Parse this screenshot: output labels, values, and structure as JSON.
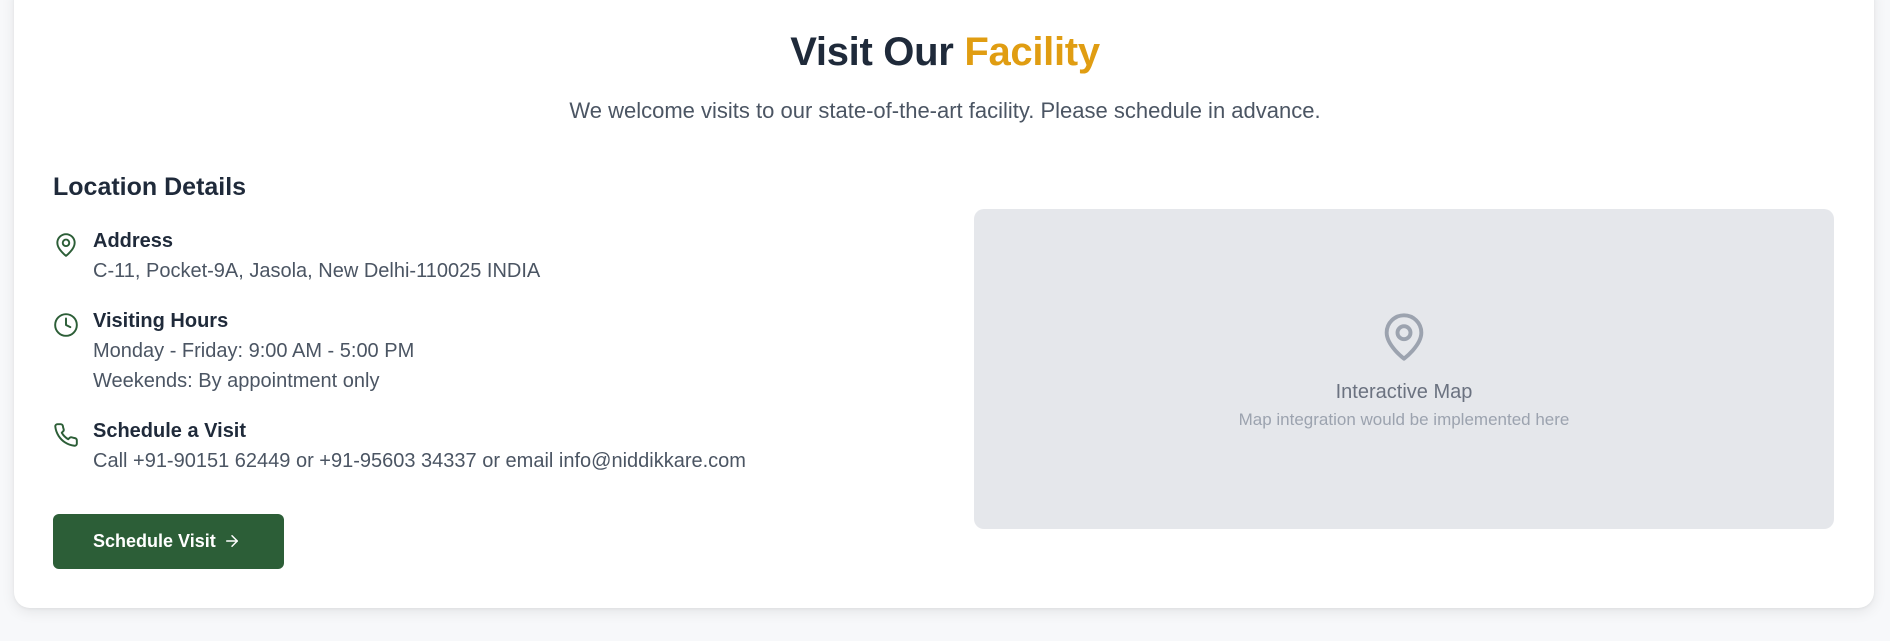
{
  "header": {
    "title_main": "Visit Our",
    "title_accent": "Facility",
    "subtitle": "We welcome visits to our state-of-the-art facility. Please schedule in advance."
  },
  "location": {
    "section_title": "Location Details",
    "address": {
      "icon": "map-pin-icon",
      "label": "Address",
      "lines": [
        "C-11, Pocket-9A, Jasola, New Delhi-110025 INDIA"
      ]
    },
    "hours": {
      "icon": "clock-icon",
      "label": "Visiting Hours",
      "lines": [
        "Monday - Friday: 9:00 AM - 5:00 PM",
        "Weekends: By appointment only"
      ]
    },
    "schedule": {
      "icon": "phone-icon",
      "label": "Schedule a Visit",
      "lines": [
        "Call +91-90151 62449 or +91-95603 34337 or email info@niddikkare.com"
      ]
    },
    "button": {
      "label": "Schedule Visit",
      "icon": "arrow-right-icon"
    }
  },
  "map": {
    "icon": "map-pin-icon",
    "title": "Interactive Map",
    "subtitle": "Map integration would be implemented here"
  },
  "colors": {
    "accent": "#e09d12",
    "brand_green": "#2c5e37",
    "heading": "#1f2a3a",
    "body_text": "#4b5563",
    "map_bg": "#e5e7eb"
  }
}
